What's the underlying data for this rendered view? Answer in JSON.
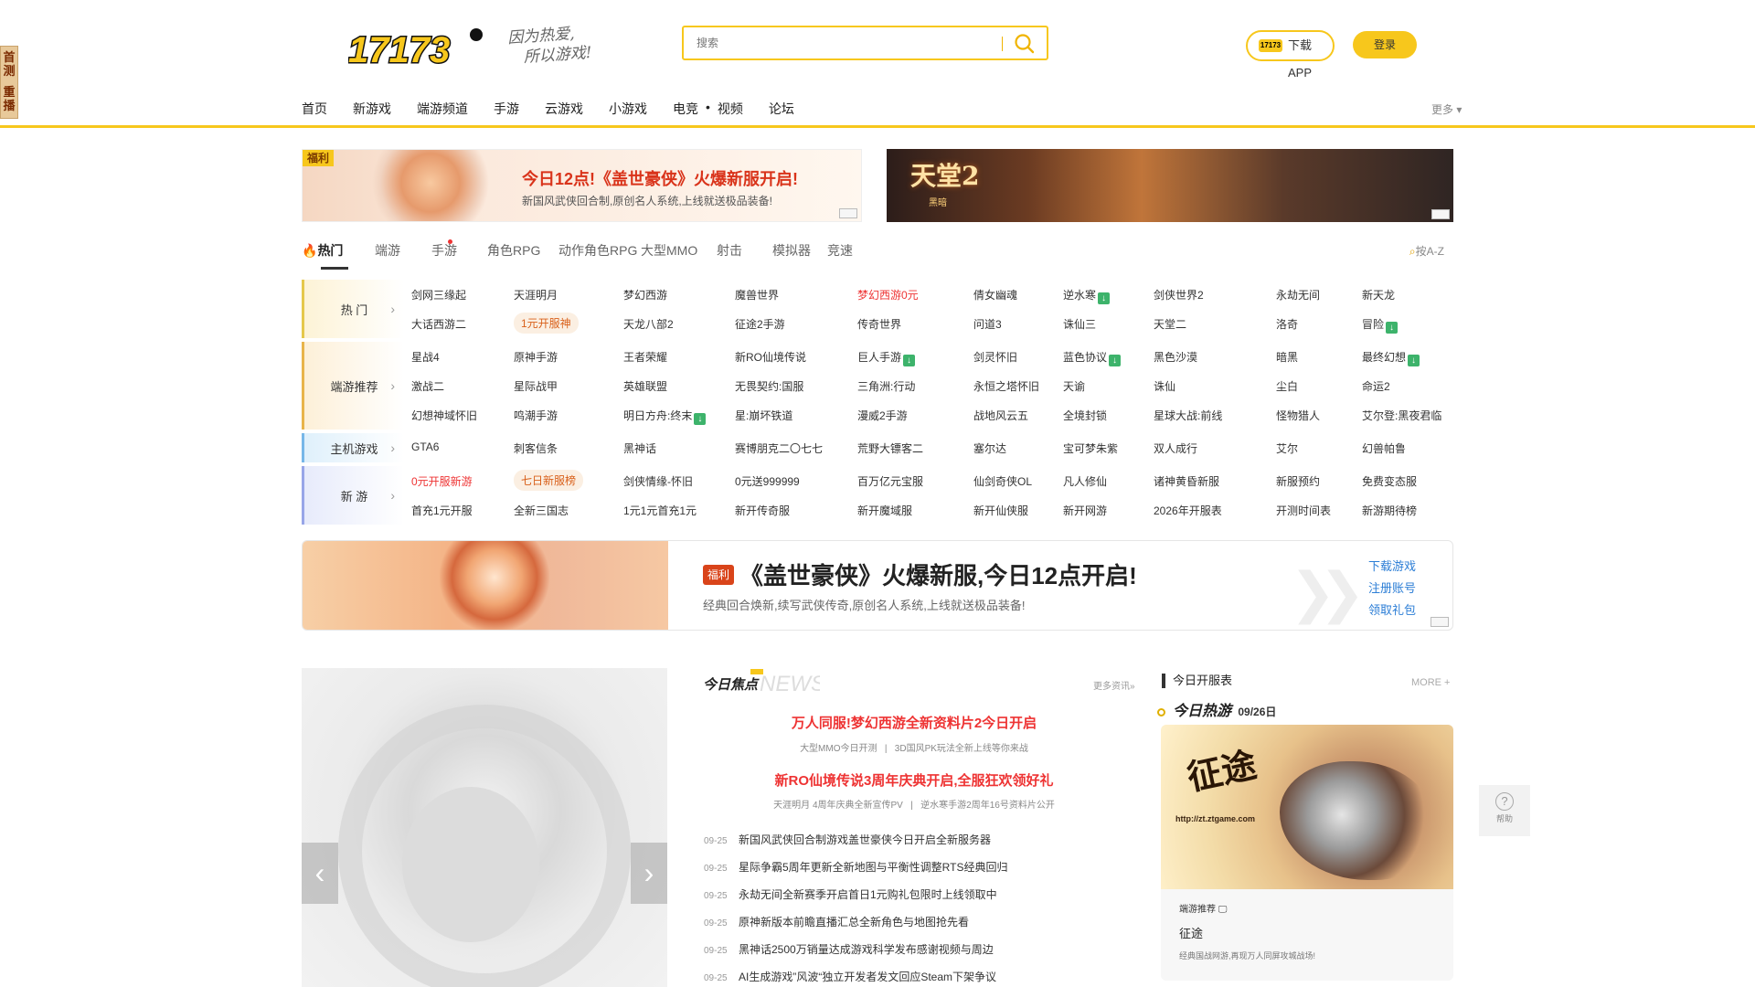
{
  "side_tag": {
    "line1": "首测",
    "line2": "重播"
  },
  "header": {
    "logo_text": "17173",
    "slogan_line1": "因为热爱,",
    "slogan_line2": "所以游戏!",
    "search_placeholder": "搜索",
    "app_button": "下载APP",
    "app_button_mini": "17173",
    "login_button": "登录",
    "more_label": "更多"
  },
  "nav": [
    "首页",
    "新游戏",
    "端游频道",
    "手游",
    "云游戏",
    "小游戏",
    "电竞",
    "•",
    "视频",
    "论坛"
  ],
  "banners": {
    "left_tag": "福利",
    "left_title": "今日12点!《盖世豪侠》火爆新服开启!",
    "left_sub": "新国风武侠回合制,原创名人系统,上线就送极品装备!",
    "right_title": "天堂2",
    "right_sub": "黑暗"
  },
  "cat_tabs": [
    "热门",
    "端游",
    "手游",
    "角色RPG",
    "动作角色RPG",
    "大型MMO",
    "射击",
    "模拟器",
    "竞速"
  ],
  "az_label": "按A-Z",
  "grid": {
    "labels": [
      "热  门",
      "端游推荐",
      "主机游戏",
      "新  游"
    ],
    "rows": [
      [
        "剑网三缘起",
        "天涯明月",
        "梦幻西游",
        "魔兽世界",
        "梦幻西游0元",
        "倩女幽魂",
        "逆水寒",
        "剑侠世界2",
        "永劫无间",
        "新天龙"
      ],
      [
        "大话西游二",
        "1元开服神",
        "天龙八部2",
        "征途2手游",
        "传奇世界",
        "问道3",
        "诛仙三",
        "天堂二",
        "洛奇",
        "冒险"
      ],
      [
        "星战4",
        "原神手游",
        "王者荣耀",
        "新RO仙境传说",
        "巨人手游",
        "剑灵怀旧",
        "蓝色协议",
        "黑色沙漠",
        "暗黑",
        "最终幻想"
      ],
      [
        "激战二",
        "星际战甲",
        "英雄联盟",
        "无畏契约:国服",
        "三角洲:行动",
        "永恒之塔怀旧",
        "天谕",
        "诛仙",
        "尘白",
        "命运2"
      ],
      [
        "幻想神域怀旧",
        "鸣潮手游",
        "明日方舟:终末",
        "星:崩坏铁道",
        "漫威2手游",
        "战地风云五",
        "全境封锁",
        "星球大战:前线",
        "怪物猎人",
        "艾尔登:黑夜君临"
      ],
      [
        "GTA6",
        "刺客信条",
        "黑神话",
        "赛博朋克二〇七七",
        "荒野大镖客二",
        "塞尔达",
        "宝可梦朱紫",
        "双人成行",
        "艾尔",
        "幻兽帕鲁"
      ],
      [
        "0元开服新游",
        "七日新服榜",
        "剑侠情缘-怀旧",
        "0元送999999",
        "百万亿元宝服",
        "仙剑奇侠OL",
        "凡人修仙",
        "诸神黄昏新服",
        "新服预约",
        "免费变态服"
      ],
      [
        "首充1元开服",
        "全新三国志",
        "1元1元首充1元",
        "新开传奇服",
        "新开魔域服",
        "新开仙侠服",
        "新开网游",
        "2026年开服表",
        "开测时间表",
        "新游期待榜"
      ]
    ]
  },
  "big_banner": {
    "tag": "福利",
    "title": "《盖世豪侠》火爆新服,今日12点开启!",
    "subtitle": "经典回合焕新,续写武侠传奇,原创名人系统,上线就送极品装备!",
    "links": [
      "下载游戏",
      "注册账号",
      "领取礼包"
    ]
  },
  "carousel": {
    "prev": "‹",
    "next": "›"
  },
  "news": {
    "logo": "今日焦点",
    "logo_en": "NEWS",
    "more": "更多资讯»",
    "headline1": "万人同服!梦幻西游全新资料片2今日开启",
    "sub1_a": "大型MMO今日开测",
    "sub1_b": "3D国风PK玩法全新上线等你来战",
    "headline2": "新RO仙境传说3周年庆典开启,全服狂欢领好礼",
    "sub2_a": "天涯明月 4周年庆典全新宣传PV",
    "sub2_b": "逆水寒手游2周年16号资料片公开",
    "items": [
      {
        "date": "09-25",
        "title": "新国风武侠回合制游戏盖世豪侠今日开启全新服务器"
      },
      {
        "date": "09-25",
        "title": "星际争霸5周年更新全新地图与平衡性调整RTS经典回归"
      },
      {
        "date": "09-25",
        "title": "永劫无间全新赛季开启首日1元购礼包限时上线领取中"
      },
      {
        "date": "09-25",
        "title": "原神新版本前瞻直播汇总全新角色与地图抢先看"
      },
      {
        "date": "09-25",
        "title": "黑神话2500万销量达成游戏科学发布感谢视频与周边"
      },
      {
        "date": "09-25",
        "title": "AI生成游戏”风波“独立开发者发文回应Steam下架争议"
      }
    ]
  },
  "right_col": {
    "title": "今日开服表",
    "more": "MORE +",
    "today_label": "今日热游",
    "today_date": "09/26日",
    "card_title_art": "征途",
    "card_url": "http://zt.ztgame.com",
    "card_meta": "端游推荐",
    "card_name": "征途",
    "card_desc": "经典国战网游,再现万人同屏攻城战场!"
  },
  "help": {
    "icon": "?",
    "label": "帮助"
  }
}
